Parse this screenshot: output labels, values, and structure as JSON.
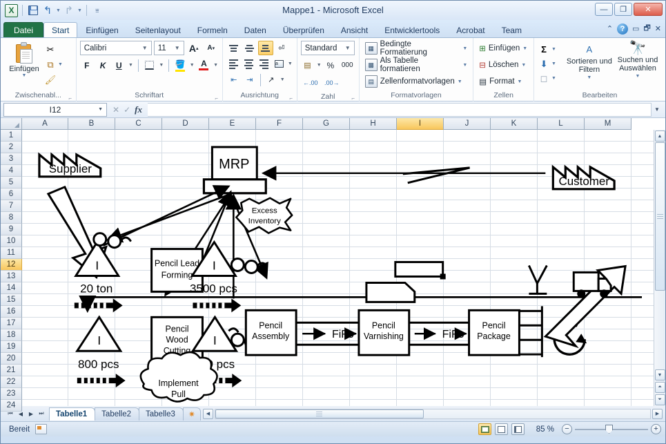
{
  "window": {
    "title": "Mappe1  -  Microsoft Excel",
    "minimize": "—",
    "maximize": "❐",
    "close": "✕"
  },
  "quick_access": {
    "app_icon": "excel-logo",
    "save": "Speichern",
    "undo": "Rückgängig",
    "redo": "Wiederholen",
    "customize": "Symbolleiste für den Schnellzugriff anpassen"
  },
  "ribbon": {
    "tabs": [
      {
        "label": "Datei",
        "active": false,
        "file": true
      },
      {
        "label": "Start",
        "active": true
      },
      {
        "label": "Einfügen",
        "active": false
      },
      {
        "label": "Seitenlayout",
        "active": false
      },
      {
        "label": "Formeln",
        "active": false
      },
      {
        "label": "Daten",
        "active": false
      },
      {
        "label": "Überprüfen",
        "active": false
      },
      {
        "label": "Ansicht",
        "active": false
      },
      {
        "label": "Entwicklertools",
        "active": false
      },
      {
        "label": "Acrobat",
        "active": false
      },
      {
        "label": "Team",
        "active": false
      }
    ],
    "help": "?",
    "collapse": "⌃",
    "groups": {
      "clipboard": {
        "title": "Zwischenabl...",
        "paste": "Einfügen",
        "cut": "Ausschneiden",
        "copy": "Kopieren",
        "format_painter": "Format übertragen"
      },
      "font": {
        "title": "Schriftart",
        "font_name": "Calibri",
        "font_size": "11",
        "grow": "A",
        "shrink": "A",
        "bold": "F",
        "italic": "K",
        "underline": "U",
        "borders": "Rahmen",
        "fill_color": "Füllfarbe",
        "font_color": "A"
      },
      "alignment": {
        "title": "Ausrichtung",
        "align_top": "Oben ausrichten",
        "align_middle": "Zentriert ausrichten",
        "align_bottom": "Unten ausrichten",
        "wrap_text": "Zeilenumbruch",
        "align_left": "Linksbündig",
        "align_center": "Zentriert",
        "align_right": "Rechtsbündig",
        "merge": "Verbinden und zentrieren",
        "indent_decrease": "Einzug verkleinern",
        "indent_increase": "Einzug vergrößern",
        "orientation": "Ausrichtung"
      },
      "number": {
        "title": "Zahl",
        "format": "Standard",
        "currency": "Buchhaltungszahlenformat",
        "percent": "%",
        "thousands": "000",
        "decimal_increase": "Dezimalstelle hinzufügen",
        "decimal_decrease": "Dezimalstelle löschen"
      },
      "styles": {
        "title": "Formatvorlagen",
        "conditional": "Bedingte Formatierung",
        "as_table": "Als Tabelle formatieren",
        "cell_styles": "Zellenformatvorlagen"
      },
      "cells": {
        "title": "Zellen",
        "insert": "Einfügen",
        "delete": "Löschen",
        "format": "Format"
      },
      "editing": {
        "title": "Bearbeiten",
        "autosum": "Σ",
        "fill": "Füllbereich",
        "clear": "Löschen",
        "sort_filter": "Sortieren und Filtern",
        "find_select": "Suchen und Auswählen"
      }
    }
  },
  "formula_bar": {
    "name_box": "I12",
    "cancel": "✕",
    "confirm": "✓",
    "function_icon": "fx",
    "value": "",
    "expand": "▼"
  },
  "grid": {
    "columns": [
      "A",
      "B",
      "C",
      "D",
      "E",
      "F",
      "G",
      "H",
      "I",
      "J",
      "K",
      "L",
      "M"
    ],
    "selected_column": "I",
    "rows": [
      1,
      2,
      3,
      4,
      5,
      6,
      7,
      8,
      9,
      10,
      11,
      12,
      13,
      14,
      15,
      16,
      17,
      18,
      19,
      20,
      21,
      22,
      23,
      24
    ],
    "selected_row": 12,
    "active_cell": "I12"
  },
  "diagram": {
    "type": "value-stream-map",
    "supplier": "Supplier",
    "customer": "Customer",
    "mrp": "MRP",
    "kaizen_burst": "Excess\nInventory",
    "kaizen_burst_line1": "Excess",
    "kaizen_burst_line2": "Inventory",
    "kaizen_cloud_line1": "Implement",
    "kaizen_cloud_line2": "Pull",
    "processes": [
      {
        "line1": "Pencil Lead",
        "line2": "Forming"
      },
      {
        "line1": "Pencil",
        "line2": "Wood",
        "line3": "Cutting"
      },
      {
        "line1": "Pencil",
        "line2": "Assembly"
      },
      {
        "line1": "Pencil",
        "line2": "Varnishing"
      },
      {
        "line1": "Pencil",
        "line2": "Package"
      }
    ],
    "inventories": [
      {
        "symbol": "I",
        "qty": "20 ton"
      },
      {
        "symbol": "I",
        "qty": "3500 pcs"
      },
      {
        "symbol": "I",
        "qty": "800 pcs"
      },
      {
        "symbol": "I",
        "qty": "230 pcs"
      }
    ],
    "fifo_labels": [
      "FiFo",
      "FiFo"
    ],
    "selected_shape": "rectangle"
  },
  "sheet_tabs": {
    "first": "⏮",
    "prev": "◀",
    "next": "▶",
    "last": "⏭",
    "tabs": [
      {
        "label": "Tabelle1",
        "active": true
      },
      {
        "label": "Tabelle2",
        "active": false
      },
      {
        "label": "Tabelle3",
        "active": false
      }
    ],
    "new_sheet": "Tabellenblatt einfügen"
  },
  "status_bar": {
    "state": "Bereit",
    "macro_icon": "record-macro-icon",
    "view_normal": "Normal",
    "view_layout": "Seitenlayout",
    "view_pagebreak": "Umbruchvorschau",
    "zoom": "85 %",
    "zoom_out": "−",
    "zoom_in": "+"
  },
  "colors": {
    "excel_green": "#217346",
    "selection_orange": "#f8c65c",
    "header_blue": "#33465c",
    "grid_line": "#d6dde5"
  }
}
